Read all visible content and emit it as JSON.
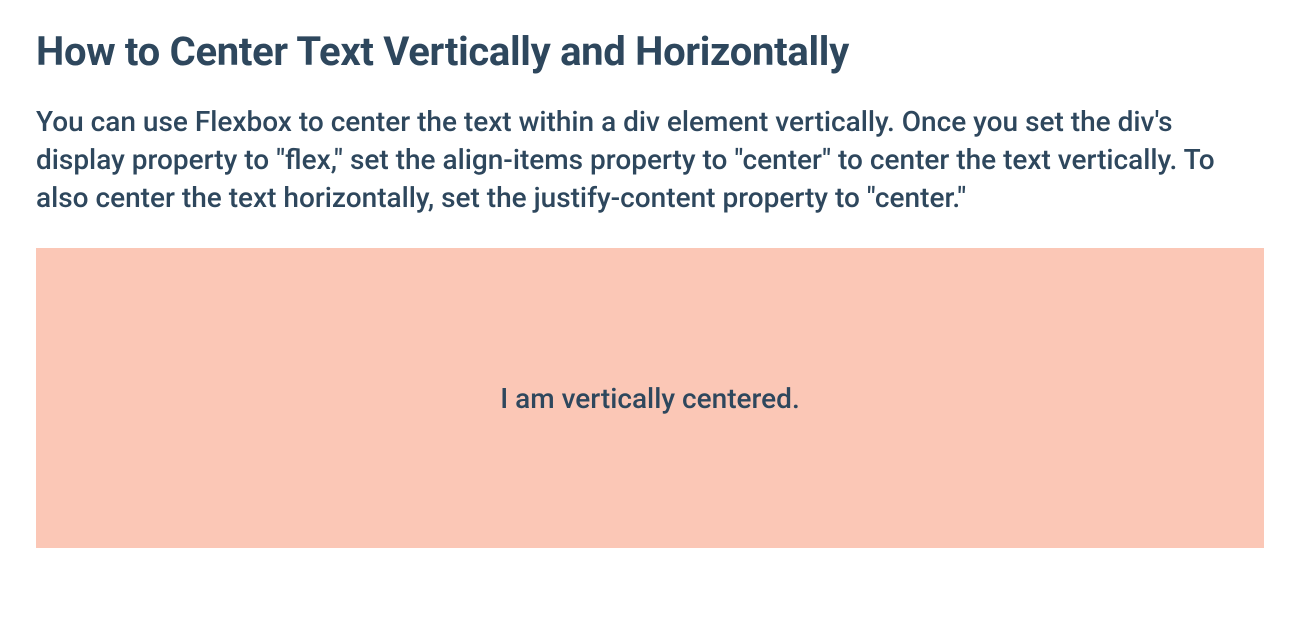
{
  "heading": "How to Center Text Vertically and Horizontally",
  "description": "You can use Flexbox to center the text within a div element vertically. Once you set the div's display property to \"flex,\" set the align-items property to \"center\" to center the text vertically. To also center the text horizontally, set the justify-content property to \"center.\"",
  "demo": {
    "text": "I am vertically centered."
  }
}
